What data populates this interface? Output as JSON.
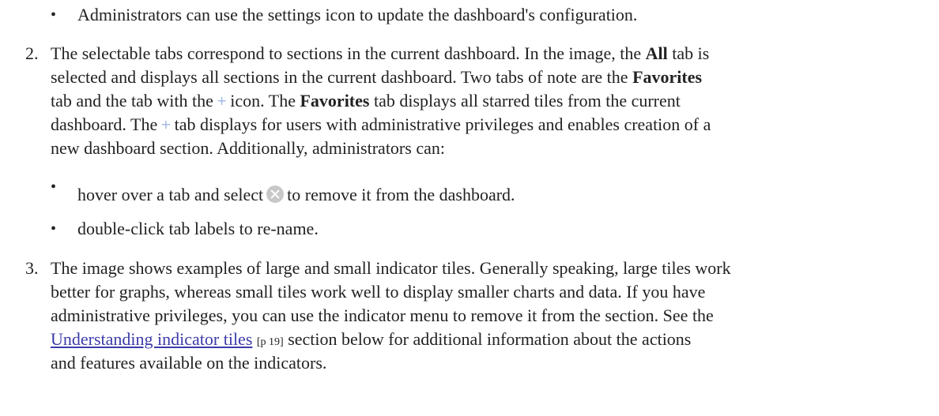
{
  "bullet_admin_settings": "Administrators can use the settings icon to update the dashboard's configuration.",
  "item2": {
    "number": "2.",
    "l1_a": "The selectable tabs correspond to sections in the current dashboard. In the image, the ",
    "l1_b": "All",
    "l1_c": " tab is",
    "l2_a": "selected and displays all sections in the current dashboard. Two tabs of note are the ",
    "l2_b": "Favorites",
    "l3_a": "tab and the tab with the",
    "l3_plus": "+",
    "l3_b": "icon. The ",
    "l3_c": "Favorites",
    "l3_d": " tab displays all starred tiles from the current",
    "l4_a": "dashboard. The",
    "l4_plus": "+",
    "l4_b": "tab displays for users with administrative privileges and enables creation of a",
    "l5": "new dashboard section. Additionally, administrators can:",
    "bullet1_a": "hover over a tab and select",
    "bullet1_b": "to remove it from the dashboard.",
    "bullet2": "double-click tab labels to re-name."
  },
  "item3": {
    "number": "3.",
    "l1": "The image shows examples of large and small indicator tiles. Generally speaking, large tiles work",
    "l2": "better for graphs, whereas small tiles work well to display smaller charts and data. If you have",
    "l3": "administrative privileges, you can use the indicator menu to remove it from the section. See the",
    "l4_link": "Understanding indicator tiles",
    "l4_ref": "[p 19]",
    "l4_b": " section below for additional information about the actions",
    "l5": "and features available on the indicators."
  },
  "icons": {
    "remove": "close-circle-icon",
    "add": "plus-icon"
  }
}
